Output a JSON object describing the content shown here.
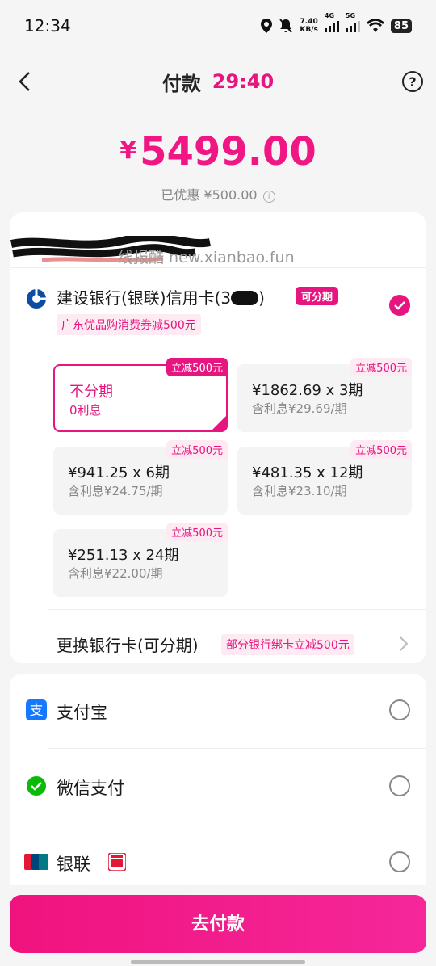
{
  "status_bar": {
    "time": "12:34",
    "net_speed": "7.40",
    "net_unit": "KB/s",
    "signal1": "4G",
    "signal2": "5G",
    "battery": "85"
  },
  "nav": {
    "title": "付款",
    "countdown": "29:40",
    "back_icon": "chevron-left-icon",
    "help_symbol": "?"
  },
  "payment": {
    "currency": "¥",
    "amount": "5499.00",
    "discount_text": "已优惠 ¥500.00",
    "info_symbol": "i"
  },
  "watermark": "线报酷 new.xianbao.fun",
  "credit_card": {
    "bank_name": "建设银行(银联)信用卡(3",
    "bank_name_suffix": ")",
    "installment_tag": "可分期",
    "promo": "广东优品购消费券减500元",
    "selected": true,
    "options": [
      {
        "tag": "立减500元",
        "main": "不分期",
        "sub": "0利息",
        "selected": true
      },
      {
        "tag": "立减500元",
        "main": "¥1862.69 x 3期",
        "sub": "含利息¥29.69/期",
        "selected": false
      },
      {
        "tag": "立减500元",
        "main": "¥941.25 x 6期",
        "sub": "含利息¥24.75/期",
        "selected": false
      },
      {
        "tag": "立减500元",
        "main": "¥481.35 x 12期",
        "sub": "含利息¥23.10/期",
        "selected": false
      },
      {
        "tag": "立减500元",
        "main": "¥251.13 x 24期",
        "sub": "含利息¥22.00/期",
        "selected": false
      }
    ],
    "change_card_label": "更换银行卡(可分期)",
    "change_card_promo": "部分银行绑卡立减500元"
  },
  "methods": [
    {
      "label": "支付宝",
      "icon": "alipay-icon",
      "color": "#1677ff"
    },
    {
      "label": "微信支付",
      "icon": "wechat-pay-icon",
      "color": "#09bb07"
    },
    {
      "label": "银联",
      "icon": "unionpay-icon",
      "color": "#e21836"
    }
  ],
  "cloud_pay_badge": "云闪付",
  "pay_button": "去付款",
  "colors": {
    "accent": "#e6157f",
    "background": "#f5f5f5"
  }
}
